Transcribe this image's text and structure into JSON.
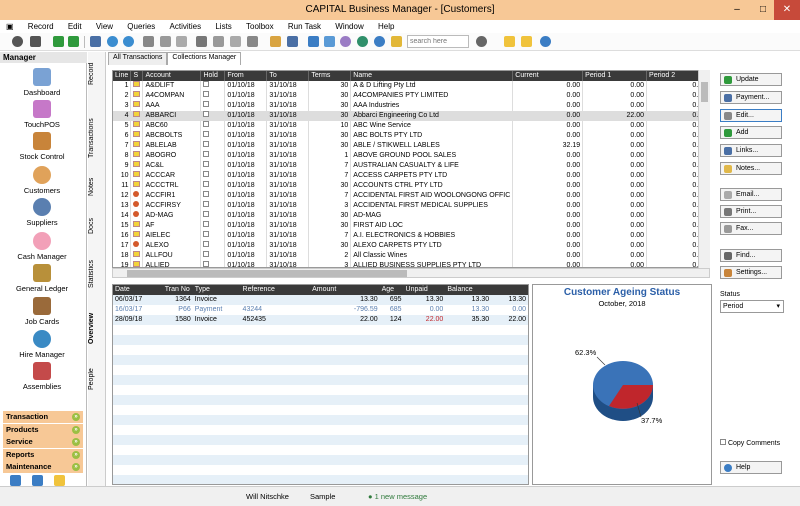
{
  "window": {
    "title": "CAPITAL Business Manager - [Customers]",
    "min": "–",
    "max": "□",
    "close": "✕"
  },
  "menu": [
    "Record",
    "Edit",
    "View",
    "Queries",
    "Activities",
    "Lists",
    "Toolbox",
    "Run Task",
    "Window",
    "Help"
  ],
  "toolbar": {
    "search_placeholder": "search here"
  },
  "manager": {
    "title": "Manager",
    "modules": [
      "Dashboard",
      "TouchPOS",
      "Stock Control",
      "Customers",
      "Suppliers",
      "Cash Manager",
      "General Ledger",
      "Job Cards",
      "Hire Manager",
      "Assemblies"
    ],
    "sections": [
      "Transaction",
      "Products",
      "Service",
      "Reports",
      "Maintenance"
    ]
  },
  "side_tabs": [
    "Record",
    "Transactions",
    "Notes",
    "Docs",
    "Statistics",
    "Overview",
    "People"
  ],
  "tabs": [
    "All Transactions",
    "Collections Manager"
  ],
  "grid": {
    "headers": [
      "Line",
      "S",
      "Account",
      "Hold",
      "From",
      "To",
      "Terms",
      "Name",
      "Current",
      "Period 1",
      "Period 2"
    ],
    "rows": [
      [
        "1",
        "!",
        "A&DLIFT",
        "",
        "01/10/18",
        "31/10/18",
        "30",
        "A & D Lifting Pty Ltd",
        "0.00",
        "0.00",
        "0.00"
      ],
      [
        "2",
        "!",
        "A4COMPAN",
        "",
        "01/10/18",
        "31/10/18",
        "30",
        "A4COMPANIES PTY LIMITED",
        "0.00",
        "0.00",
        "0.00"
      ],
      [
        "3",
        "!",
        "AAA",
        "",
        "01/10/18",
        "31/10/18",
        "30",
        "AAA Industries",
        "0.00",
        "0.00",
        "0.00"
      ],
      [
        "4",
        "!",
        "ABBARCI",
        "",
        "01/10/18",
        "31/10/18",
        "30",
        "Abbarci Engineering Co Ltd",
        "0.00",
        "22.00",
        "0.00"
      ],
      [
        "5",
        "!",
        "ABC60",
        "",
        "01/10/18",
        "31/10/18",
        "10",
        "ABC Wine Service",
        "0.00",
        "0.00",
        "0.00"
      ],
      [
        "6",
        "!",
        "ABCBOLTS",
        "",
        "01/10/18",
        "31/10/18",
        "30",
        "ABC BOLTS PTY LTD",
        "0.00",
        "0.00",
        "0.00"
      ],
      [
        "7",
        "!",
        "ABLELAB",
        "",
        "01/10/18",
        "31/10/18",
        "30",
        "ABLE / STIKWELL LABLES",
        "32.19",
        "0.00",
        "0.00"
      ],
      [
        "8",
        "!",
        "ABOGRO",
        "",
        "01/10/18",
        "31/10/18",
        "1",
        "ABOVE GROUND POOL SALES",
        "0.00",
        "0.00",
        "0.00"
      ],
      [
        "9",
        "!",
        "AC&L",
        "",
        "01/10/18",
        "31/10/18",
        "7",
        "AUSTRALIAN CASUALTY & LIFE",
        "0.00",
        "0.00",
        "0.00"
      ],
      [
        "10",
        "!",
        "ACCCAR",
        "",
        "01/10/18",
        "31/10/18",
        "7",
        "ACCESS CARPETS PTY LTD",
        "0.00",
        "0.00",
        "0.00"
      ],
      [
        "11",
        "!",
        "ACCCTRL",
        "",
        "01/10/18",
        "31/10/18",
        "30",
        "ACCOUNTS CTRL PTY LTD",
        "0.00",
        "0.00",
        "0.00"
      ],
      [
        "12",
        "●",
        "ACCFIR1",
        "",
        "01/10/18",
        "31/10/18",
        "7",
        "ACCIDENTAL FIRST AID WOOLONGONG OFFIC",
        "0.00",
        "0.00",
        "0.00"
      ],
      [
        "13",
        "●",
        "ACCFIRSY",
        "",
        "01/10/18",
        "31/10/18",
        "3",
        "ACCIDENTAL FIRST MEDICAL SUPPLIES",
        "0.00",
        "0.00",
        "0.00"
      ],
      [
        "14",
        "●",
        "AD-MAG",
        "",
        "01/10/18",
        "31/10/18",
        "30",
        "AD-MAG",
        "0.00",
        "0.00",
        "0.00"
      ],
      [
        "15",
        "!",
        "AF",
        "",
        "01/10/18",
        "31/10/18",
        "30",
        "FIRST AID LOC",
        "0.00",
        "0.00",
        "0.00"
      ],
      [
        "16",
        "!",
        "AIELEC",
        "",
        "01/10/18",
        "31/10/18",
        "7",
        "A.I. ELECTRONICS & HOBBIES",
        "0.00",
        "0.00",
        "0.00"
      ],
      [
        "17",
        "●",
        "ALEXO",
        "",
        "01/10/18",
        "31/10/18",
        "30",
        "ALEXO CARPETS PTY LTD",
        "0.00",
        "0.00",
        "0.00"
      ],
      [
        "18",
        "!",
        "ALLFOU",
        "",
        "01/10/18",
        "31/10/18",
        "2",
        "All Classic Wines",
        "0.00",
        "0.00",
        "0.00"
      ],
      [
        "19",
        "!",
        "ALLIED",
        "",
        "01/10/18",
        "31/10/18",
        "3",
        "ALLIED BUSINESS SUPPLIES PTY LTD",
        "0.00",
        "0.00",
        "0.00"
      ]
    ]
  },
  "transactions": {
    "headers": [
      "Date",
      "Tran No",
      "Type",
      "Reference",
      "Amount",
      "Age",
      "Unpaid",
      "Balance",
      ""
    ],
    "rows": [
      [
        "06/03/17",
        "1364",
        "Invoice",
        "",
        "13.30",
        "695",
        "13.30",
        "13.30",
        "13.30"
      ],
      [
        "16/03/17",
        "P66",
        "Payment",
        "43244",
        "-796.59",
        "685",
        "0.00",
        "13.30",
        "0.00"
      ],
      [
        "28/09/18",
        "1580",
        "Invoice",
        "452435",
        "22.00",
        "124",
        "22.00",
        "35.30",
        "22.00"
      ]
    ]
  },
  "ageing": {
    "title": "Customer Ageing Status",
    "subtitle": "October, 2018",
    "label_a": "62.3%",
    "label_b": "37.7%",
    "color_a": "#3a73b8",
    "color_b": "#c0262c"
  },
  "actions": [
    "Update",
    "Payment...",
    "Edit...",
    "Add",
    "Links...",
    "Notes...",
    "Email...",
    "Print...",
    "Fax...",
    "Find...",
    "Settings..."
  ],
  "status": {
    "label": "Status",
    "value": "Period"
  },
  "copy_comments": "Copy Comments",
  "help": "Help",
  "statusbar": {
    "user": "Will Nitschke",
    "company": "Sample",
    "message": "1 new message"
  }
}
